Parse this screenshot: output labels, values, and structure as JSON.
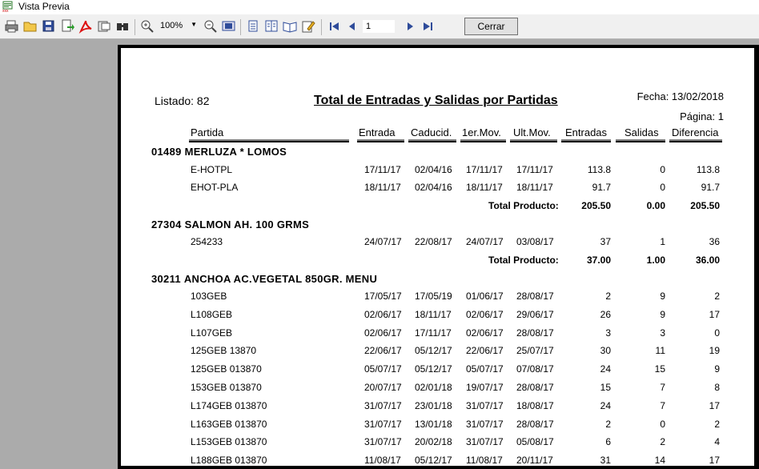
{
  "window": {
    "title": "Vista Previa"
  },
  "toolbar": {
    "zoom": "100%",
    "page": "1",
    "close_label": "Cerrar"
  },
  "report": {
    "listado": "Listado: 82",
    "title": "Total de Entradas y Salidas por Partidas",
    "fecha": "Fecha: 13/02/2018",
    "pagina": "Página: 1",
    "columns": [
      "Partida",
      "Entrada",
      "Caducid.",
      "1er.Mov.",
      "Ult.Mov.",
      "Entradas",
      "Salidas",
      "Diferencia"
    ],
    "groups": [
      {
        "code": "01489",
        "name": "MERLUZA * LOMOS",
        "rows": [
          [
            "E-HOTPL",
            "17/11/17",
            "02/04/16",
            "17/11/17",
            "17/11/17",
            "113.8",
            "0",
            "113.8"
          ],
          [
            "EHOT-PLA",
            "18/11/17",
            "02/04/16",
            "18/11/17",
            "18/11/17",
            "91.7",
            "0",
            "91.7"
          ]
        ],
        "total_label": "Total Producto:",
        "total": [
          "205.50",
          "0.00",
          "205.50"
        ]
      },
      {
        "code": "27304",
        "name": "SALMON AH. 100 GRMS",
        "rows": [
          [
            "254233",
            "24/07/17",
            "22/08/17",
            "24/07/17",
            "03/08/17",
            "37",
            "1",
            "36"
          ]
        ],
        "total_label": "Total Producto:",
        "total": [
          "37.00",
          "1.00",
          "36.00"
        ]
      },
      {
        "code": "30211",
        "name": "ANCHOA AC.VEGETAL 850GR. MENU",
        "rows": [
          [
            "103GEB",
            "17/05/17",
            "17/05/19",
            "01/06/17",
            "28/08/17",
            "2",
            "9",
            "2"
          ],
          [
            "L108GEB",
            "02/06/17",
            "18/11/17",
            "02/06/17",
            "29/06/17",
            "26",
            "9",
            "17"
          ],
          [
            "L107GEB",
            "02/06/17",
            "17/11/17",
            "02/06/17",
            "28/08/17",
            "3",
            "3",
            "0"
          ],
          [
            "125GEB 13870",
            "22/06/17",
            "05/12/17",
            "22/06/17",
            "25/07/17",
            "30",
            "11",
            "19"
          ],
          [
            "125GEB 013870",
            "05/07/17",
            "05/12/17",
            "05/07/17",
            "07/08/17",
            "24",
            "15",
            "9"
          ],
          [
            "153GEB 013870",
            "20/07/17",
            "02/01/18",
            "19/07/17",
            "28/08/17",
            "15",
            "7",
            "8"
          ],
          [
            "L174GEB 013870",
            "31/07/17",
            "23/01/18",
            "31/07/17",
            "18/08/17",
            "24",
            "7",
            "17"
          ],
          [
            "L163GEB 013870",
            "31/07/17",
            "13/01/18",
            "31/07/17",
            "28/08/17",
            "2",
            "0",
            "2"
          ],
          [
            "L153GEB 013870",
            "31/07/17",
            "20/02/18",
            "31/07/17",
            "05/08/17",
            "6",
            "2",
            "4"
          ],
          [
            "L188GEB 013870",
            "11/08/17",
            "05/12/17",
            "11/08/17",
            "20/11/17",
            "31",
            "14",
            "17"
          ]
        ]
      }
    ]
  }
}
